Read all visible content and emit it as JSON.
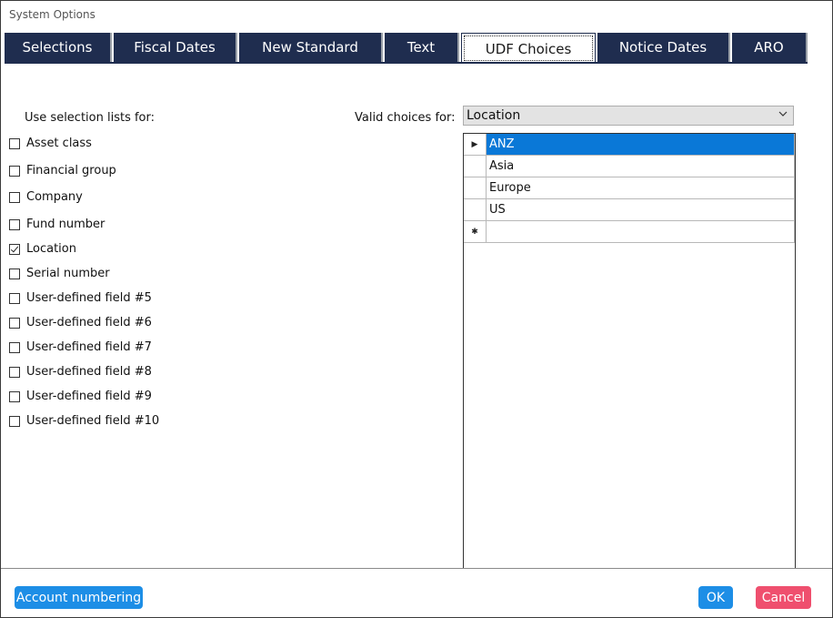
{
  "window": {
    "title": "System Options"
  },
  "tabs": [
    {
      "label": "Selections"
    },
    {
      "label": "Fiscal Dates"
    },
    {
      "label": "New Standard"
    },
    {
      "label": "Text"
    },
    {
      "label": "UDF Choices",
      "active": true
    },
    {
      "label": "Notice Dates"
    },
    {
      "label": "ARO"
    }
  ],
  "left": {
    "heading": "Use selection lists for:",
    "items": [
      {
        "label": "Asset class",
        "checked": false
      },
      {
        "label": "Financial group",
        "checked": false
      },
      {
        "label": "Company",
        "checked": false
      },
      {
        "label": "Fund number",
        "checked": false
      },
      {
        "label": "Location",
        "checked": true
      },
      {
        "label": "Serial number",
        "checked": false
      },
      {
        "label": "User-defined field #5",
        "checked": false
      },
      {
        "label": "User-defined field #6",
        "checked": false
      },
      {
        "label": "User-defined field #7",
        "checked": false
      },
      {
        "label": "User-defined field #8",
        "checked": false
      },
      {
        "label": "User-defined field #9",
        "checked": false
      },
      {
        "label": "User-defined field #10",
        "checked": false
      }
    ]
  },
  "right": {
    "label": "Valid choices for:",
    "selected": "Location",
    "rows": [
      {
        "value": "ANZ",
        "marker": "▶",
        "selected": true
      },
      {
        "value": "Asia",
        "marker": ""
      },
      {
        "value": "Europe",
        "marker": ""
      },
      {
        "value": "US",
        "marker": ""
      },
      {
        "value": "",
        "marker": "✱"
      }
    ]
  },
  "footer": {
    "account_label": "Account numbering",
    "ok_label": "OK",
    "cancel_label": "Cancel"
  },
  "colors": {
    "tab_bg": "#1f2d4f",
    "selected_row": "#0a78d7",
    "ok_button": "#1d8ee6",
    "cancel_button": "#ef4f6e"
  }
}
